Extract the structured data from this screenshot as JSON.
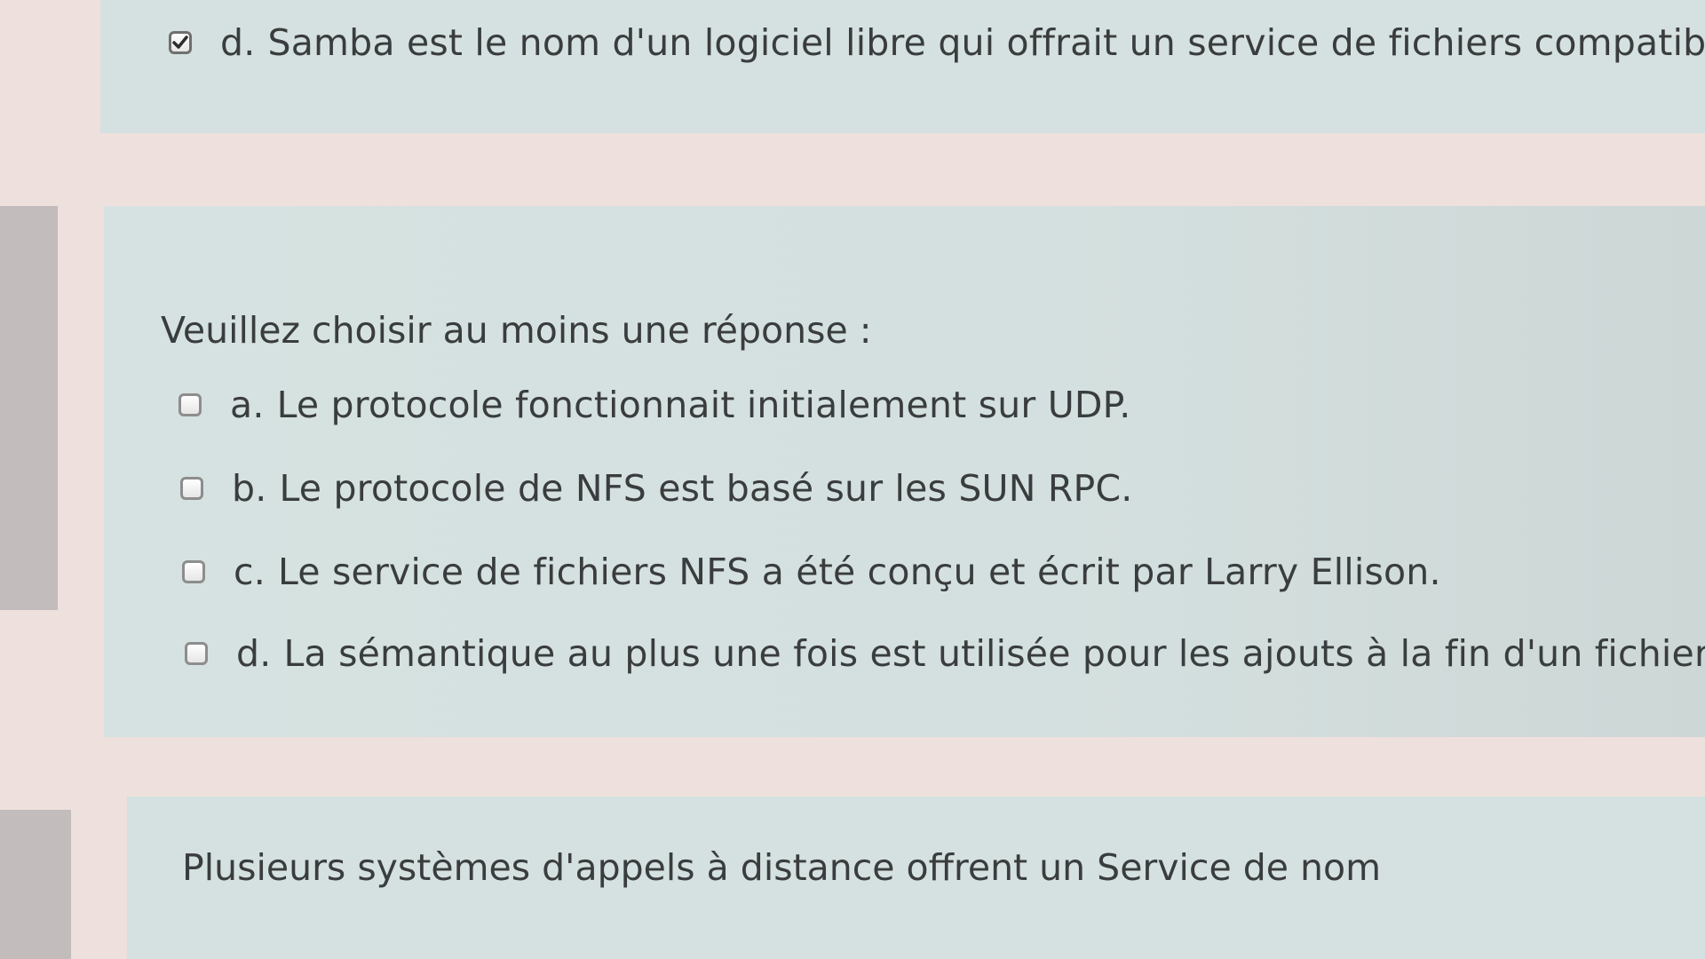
{
  "previous_question": {
    "option_d": {
      "letter": "d.",
      "text": "Samba est le nom d'un logiciel libre qui offrait un service de fichiers compatible",
      "checked": true
    }
  },
  "current_question": {
    "prompt": "Veuillez choisir au moins une réponse :",
    "options": [
      {
        "letter": "a.",
        "text": "Le protocole fonctionnait initialement sur UDP.",
        "checked": false
      },
      {
        "letter": "b.",
        "text": "Le protocole de NFS est basé sur les SUN RPC.",
        "checked": false
      },
      {
        "letter": "c.",
        "text": "Le service de fichiers NFS a été conçu et écrit par Larry Ellison.",
        "checked": false
      },
      {
        "letter": "d.",
        "text": "La sémantique au plus une fois est utilisée pour les ajouts à la fin d'un fichier.",
        "checked": false
      }
    ]
  },
  "next_question": {
    "text": "Plusieurs systèmes d'appels à distance offrent un Service de nom"
  },
  "colors": {
    "panel_background": "#d5e1e0",
    "page_background": "#eee0dc",
    "text": "#3a3d3d",
    "checkbox_border": "#8d8d8d"
  }
}
